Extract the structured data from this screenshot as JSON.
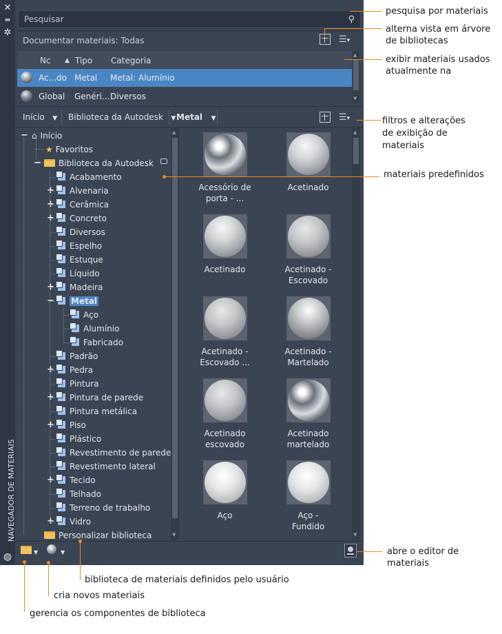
{
  "palette": {
    "vertical_title": "NAVEGADOR DE MATERIAIS",
    "search": {
      "placeholder": "Pesquisar"
    },
    "doc_materials_label": "Documentar materiais: Todas",
    "table": {
      "headers": [
        "Nc",
        "Tipo",
        "Categoria"
      ],
      "sort_indicator": "▲",
      "rows": [
        {
          "name": "Ac...do",
          "type": "Metal",
          "category": "Metal: Alumínio",
          "selected": true
        },
        {
          "name": "Global",
          "type": "Genéri...",
          "category": "Diversos",
          "selected": false
        }
      ]
    },
    "breadcrumb": [
      "Início",
      "Biblioteca da Autodesk",
      "Metal"
    ],
    "tree": {
      "root": "Início",
      "favorites": "Favoritos",
      "library": "Biblioteca da Autodesk",
      "items": [
        {
          "label": "Acabamento",
          "expandable": false
        },
        {
          "label": "Alvenaria",
          "expandable": true
        },
        {
          "label": "Cerâmica",
          "expandable": true
        },
        {
          "label": "Concreto",
          "expandable": true
        },
        {
          "label": "Diversos",
          "expandable": false
        },
        {
          "label": "Espelho",
          "expandable": false
        },
        {
          "label": "Estuque",
          "expandable": false
        },
        {
          "label": "Líquido",
          "expandable": false
        },
        {
          "label": "Madeira",
          "expandable": true
        },
        {
          "label": "Metal",
          "expandable": true,
          "expanded": true,
          "selected": true
        },
        {
          "label": "Aço",
          "child": true
        },
        {
          "label": "Alumínio",
          "child": true
        },
        {
          "label": "Fabricado",
          "child": true
        },
        {
          "label": "Padrão",
          "expandable": false
        },
        {
          "label": "Pedra",
          "expandable": true
        },
        {
          "label": "Pintura",
          "expandable": false
        },
        {
          "label": "Pintura de parede",
          "expandable": true
        },
        {
          "label": "Pintura metálica",
          "expandable": false
        },
        {
          "label": "Piso",
          "expandable": true
        },
        {
          "label": "Plástico",
          "expandable": false
        },
        {
          "label": "Revestimento de parede",
          "expandable": false
        },
        {
          "label": "Revestimento lateral",
          "expandable": false
        },
        {
          "label": "Tecido",
          "expandable": true
        },
        {
          "label": "Telhado",
          "expandable": false
        },
        {
          "label": "Terreno de trabalho",
          "expandable": false
        },
        {
          "label": "Vidro",
          "expandable": true
        }
      ],
      "custom_library": "Personalizar biblioteca"
    },
    "materials": [
      {
        "label1": "Acessório de",
        "label2": "porta - ...",
        "finish": "chrome"
      },
      {
        "label1": "Acetinado",
        "label2": "",
        "finish": "satin"
      },
      {
        "label1": "Acetinado",
        "label2": "",
        "finish": "satin"
      },
      {
        "label1": "Acetinado -",
        "label2": "Escovado",
        "finish": "brushed"
      },
      {
        "label1": "Acetinado -",
        "label2": "Escovado ...",
        "finish": "brushed"
      },
      {
        "label1": "Acetinado -",
        "label2": "Martelado",
        "finish": "hammered"
      },
      {
        "label1": "Acetinado",
        "label2": "escovado",
        "finish": "brushed"
      },
      {
        "label1": "Acetinado",
        "label2": "martelado",
        "finish": "chrome"
      },
      {
        "label1": "Aço",
        "label2": "",
        "finish": "matte"
      },
      {
        "label1": "Aço -",
        "label2": "Fundido",
        "finish": "matte"
      }
    ]
  },
  "annotations": {
    "search": "pesquisa por materiais",
    "toggle_tree_1": "alterna vista em árvore",
    "toggle_tree_2": "de bibliotecas",
    "used_1": "exibir materiais usados",
    "used_2": "atualmente na",
    "filters_1": "filtros e alterações",
    "filters_2": "de exibição de",
    "filters_3": "materiais",
    "predefined": "materiais predefinidos",
    "editor": "abre o editor de materiais",
    "user_library": "biblioteca de materiais definidos pelo usuário",
    "create": "cria novos materiais",
    "manage": "gerencia os componentes de biblioteca"
  },
  "colors": {
    "panel": "#3b4453",
    "selection": "#4a86c4",
    "callout": "#f08a1e"
  }
}
